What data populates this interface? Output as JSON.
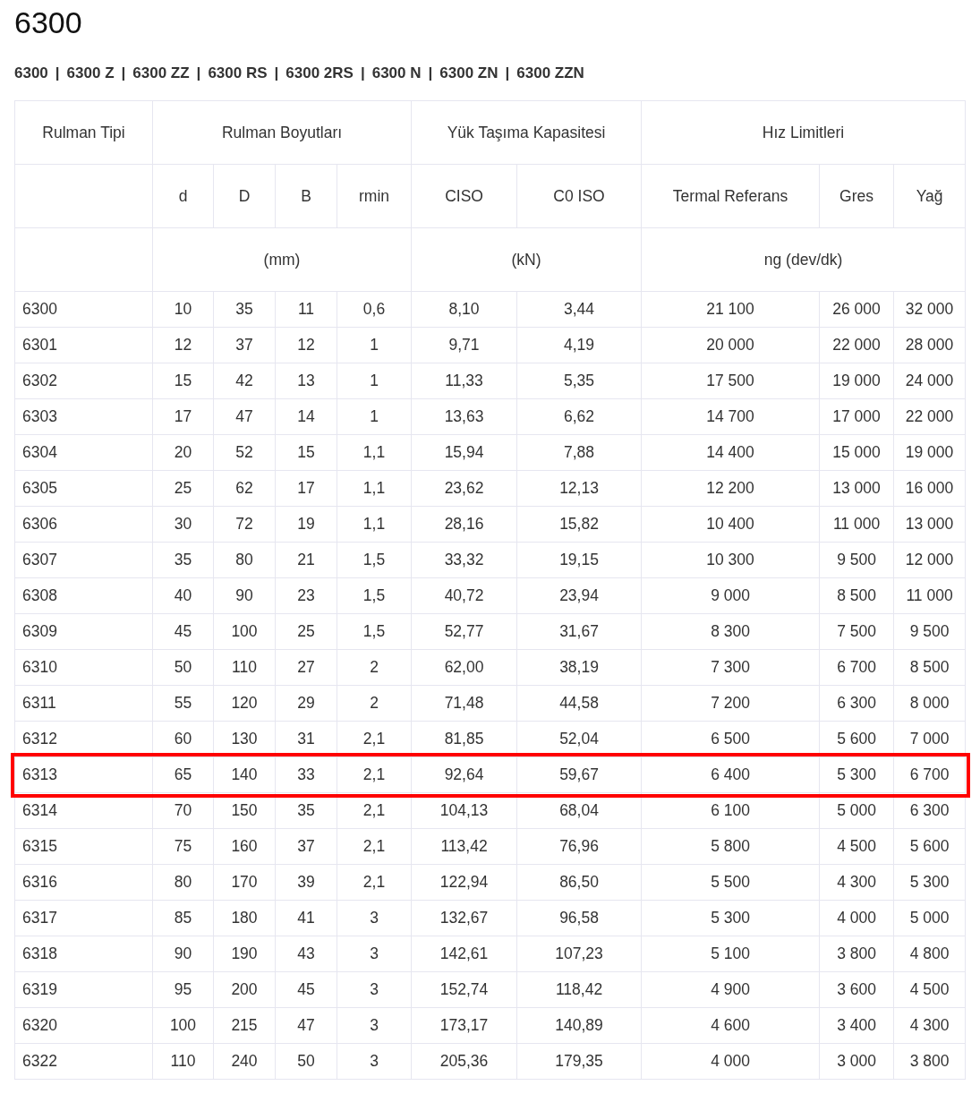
{
  "title": "6300",
  "variants": {
    "separator": "|",
    "items": [
      "6300",
      "6300 Z",
      "6300 ZZ",
      "6300 RS",
      "6300 2RS",
      "6300 N",
      "6300 ZN",
      "6300 ZZN"
    ]
  },
  "table": {
    "groups": [
      "Rulman Tipi",
      "Rulman Boyutları",
      "Yük Taşıma Kapasitesi",
      "Hız Limitleri"
    ],
    "columns": [
      "",
      "d",
      "D",
      "B",
      "rmin",
      "CISO",
      "C0 ISO",
      "Termal Referans",
      "Gres",
      "Yağ"
    ],
    "units": [
      "(mm)",
      "(kN)",
      "ng (dev/dk)"
    ],
    "rows": [
      {
        "selected": false,
        "cells": [
          "6300",
          "10",
          "35",
          "11",
          "0,6",
          "8,10",
          "3,44",
          "21 100",
          "26 000",
          "32 000"
        ]
      },
      {
        "selected": false,
        "cells": [
          "6301",
          "12",
          "37",
          "12",
          "1",
          "9,71",
          "4,19",
          "20 000",
          "22 000",
          "28 000"
        ]
      },
      {
        "selected": false,
        "cells": [
          "6302",
          "15",
          "42",
          "13",
          "1",
          "11,33",
          "5,35",
          "17 500",
          "19 000",
          "24 000"
        ]
      },
      {
        "selected": false,
        "cells": [
          "6303",
          "17",
          "47",
          "14",
          "1",
          "13,63",
          "6,62",
          "14 700",
          "17 000",
          "22 000"
        ]
      },
      {
        "selected": false,
        "cells": [
          "6304",
          "20",
          "52",
          "15",
          "1,1",
          "15,94",
          "7,88",
          "14 400",
          "15 000",
          "19 000"
        ]
      },
      {
        "selected": false,
        "cells": [
          "6305",
          "25",
          "62",
          "17",
          "1,1",
          "23,62",
          "12,13",
          "12 200",
          "13 000",
          "16 000"
        ]
      },
      {
        "selected": false,
        "cells": [
          "6306",
          "30",
          "72",
          "19",
          "1,1",
          "28,16",
          "15,82",
          "10 400",
          "11 000",
          "13 000"
        ]
      },
      {
        "selected": false,
        "cells": [
          "6307",
          "35",
          "80",
          "21",
          "1,5",
          "33,32",
          "19,15",
          "10 300",
          "9 500",
          "12 000"
        ]
      },
      {
        "selected": false,
        "cells": [
          "6308",
          "40",
          "90",
          "23",
          "1,5",
          "40,72",
          "23,94",
          "9 000",
          "8 500",
          "11 000"
        ]
      },
      {
        "selected": false,
        "cells": [
          "6309",
          "45",
          "100",
          "25",
          "1,5",
          "52,77",
          "31,67",
          "8 300",
          "7 500",
          "9 500"
        ]
      },
      {
        "selected": false,
        "cells": [
          "6310",
          "50",
          "110",
          "27",
          "2",
          "62,00",
          "38,19",
          "7 300",
          "6 700",
          "8 500"
        ]
      },
      {
        "selected": false,
        "cells": [
          "6311",
          "55",
          "120",
          "29",
          "2",
          "71,48",
          "44,58",
          "7 200",
          "6 300",
          "8 000"
        ]
      },
      {
        "selected": false,
        "cells": [
          "6312",
          "60",
          "130",
          "31",
          "2,1",
          "81,85",
          "52,04",
          "6 500",
          "5 600",
          "7 000"
        ]
      },
      {
        "selected": true,
        "cells": [
          "6313",
          "65",
          "140",
          "33",
          "2,1",
          "92,64",
          "59,67",
          "6 400",
          "5 300",
          "6 700"
        ]
      },
      {
        "selected": false,
        "cells": [
          "6314",
          "70",
          "150",
          "35",
          "2,1",
          "104,13",
          "68,04",
          "6 100",
          "5 000",
          "6 300"
        ]
      },
      {
        "selected": false,
        "cells": [
          "6315",
          "75",
          "160",
          "37",
          "2,1",
          "113,42",
          "76,96",
          "5 800",
          "4 500",
          "5 600"
        ]
      },
      {
        "selected": false,
        "cells": [
          "6316",
          "80",
          "170",
          "39",
          "2,1",
          "122,94",
          "86,50",
          "5 500",
          "4 300",
          "5 300"
        ]
      },
      {
        "selected": false,
        "cells": [
          "6317",
          "85",
          "180",
          "41",
          "3",
          "132,67",
          "96,58",
          "5 300",
          "4 000",
          "5 000"
        ]
      },
      {
        "selected": false,
        "cells": [
          "6318",
          "90",
          "190",
          "43",
          "3",
          "142,61",
          "107,23",
          "5 100",
          "3 800",
          "4 800"
        ]
      },
      {
        "selected": false,
        "cells": [
          "6319",
          "95",
          "200",
          "45",
          "3",
          "152,74",
          "118,42",
          "4 900",
          "3 600",
          "4 500"
        ]
      },
      {
        "selected": false,
        "cells": [
          "6320",
          "100",
          "215",
          "47",
          "3",
          "173,17",
          "140,89",
          "4 600",
          "3 400",
          "4 300"
        ]
      },
      {
        "selected": false,
        "cells": [
          "6322",
          "110",
          "240",
          "50",
          "3",
          "205,36",
          "179,35",
          "4 000",
          "3 000",
          "3 800"
        ]
      }
    ]
  }
}
